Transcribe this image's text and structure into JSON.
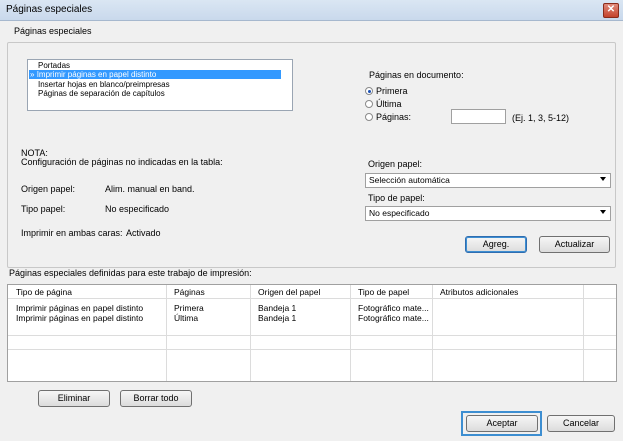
{
  "window": {
    "title": "Páginas especiales",
    "close_glyph": "✕"
  },
  "group": {
    "label": "Páginas especiales"
  },
  "types_list": {
    "items": [
      {
        "label": "Portadas",
        "selected": false
      },
      {
        "label": "Imprimir páginas en papel distinto",
        "selected": true,
        "marker": "»"
      },
      {
        "label": "Insertar hojas en blanco/preimpresas",
        "selected": false
      },
      {
        "label": "Páginas de separación de capítulos",
        "selected": false
      }
    ]
  },
  "pages_in_document": {
    "label": "Páginas en documento:",
    "options": [
      {
        "label": "Primera",
        "checked": true
      },
      {
        "label": "Última",
        "checked": false
      },
      {
        "label": "Páginas:",
        "checked": false
      }
    ],
    "pages_value": "",
    "example": "(Ej. 1, 3, 5-12)"
  },
  "nota": {
    "heading": "NOTA:",
    "subheading": "Configuración de páginas no indicadas en la tabla:",
    "rows": [
      {
        "label": "Origen papel:",
        "value": "Alim. manual en band."
      },
      {
        "label": "Tipo papel:",
        "value": "No especificado"
      },
      {
        "label": "Imprimir en ambas caras:",
        "value": "Activado"
      }
    ]
  },
  "source": {
    "label": "Origen papel:",
    "value": "Selección automática"
  },
  "type": {
    "label": "Tipo de papel:",
    "value": "No especificado"
  },
  "buttons": {
    "add": "Agreg.",
    "update": "Actualizar",
    "delete": "Eliminar",
    "clear_all": "Borrar todo",
    "ok": "Aceptar",
    "cancel": "Cancelar"
  },
  "table": {
    "caption": "Páginas especiales definidas para este trabajo de impresión:",
    "headers": [
      "Tipo de página",
      "Páginas",
      "Origen del papel",
      "Tipo de papel",
      "Atributos adicionales"
    ],
    "rows": [
      [
        "Imprimir páginas en papel distinto",
        "Primera",
        "Bandeja 1",
        "Fotográfico mate...",
        ""
      ],
      [
        "Imprimir páginas en papel distinto",
        "Última",
        "Bandeja 1",
        "Fotográfico mate...",
        ""
      ]
    ]
  },
  "colors": {
    "selection": "#3399ff",
    "focus": "#3d8ed1"
  }
}
